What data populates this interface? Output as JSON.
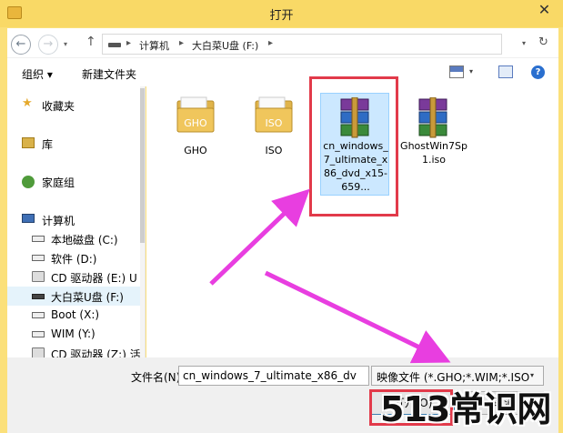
{
  "window": {
    "title": "打开",
    "close_glyph": "✕"
  },
  "nav": {
    "back_glyph": "←",
    "forward_glyph": "→",
    "dropdown_glyph": "▾",
    "up_glyph": "↑",
    "refresh_glyph": "↻"
  },
  "address": {
    "crumbs": [
      "计算机",
      "大白菜U盘 (F:)"
    ],
    "separator": "▸"
  },
  "toolbar": {
    "organize": "组织 ▾",
    "new_folder": "新建文件夹",
    "view_dd": "▾",
    "help": "?"
  },
  "sidebar": {
    "items": [
      {
        "label": "收藏夹",
        "icon": "star-icon"
      },
      {
        "label": "库",
        "icon": "library-icon"
      },
      {
        "label": "家庭组",
        "icon": "homegroup-icon"
      },
      {
        "label": "计算机",
        "icon": "computer-icon"
      },
      {
        "label": "本地磁盘 (C:)",
        "icon": "drive-icon"
      },
      {
        "label": "软件 (D:)",
        "icon": "drive-icon"
      },
      {
        "label": "CD 驱动器 (E:) U",
        "icon": "cd-drive-icon"
      },
      {
        "label": "大白菜U盘 (F:)",
        "icon": "usb-drive-icon"
      },
      {
        "label": "Boot (X:)",
        "icon": "drive-icon"
      },
      {
        "label": "WIM (Y:)",
        "icon": "drive-icon"
      },
      {
        "label": "CD 驱动器 (Z:) 活",
        "icon": "cd-drive-icon"
      }
    ]
  },
  "files": [
    {
      "name": "GHO",
      "icon": "folder-icon",
      "badge": "GHO"
    },
    {
      "name": "ISO",
      "icon": "folder-icon",
      "badge": "ISO"
    },
    {
      "name": "cn_windows_7_ultimate_x86_dvd_x15-659...",
      "icon": "rar-archive-icon"
    },
    {
      "name": "GhostWin7Sp1.iso",
      "icon": "rar-archive-icon"
    }
  ],
  "bottom": {
    "filename_label": "文件名(N):",
    "filename_value": "cn_windows_7_ultimate_x86_dv",
    "filter_value": "映像文件 (*.GHO;*.WIM;*.ISO",
    "filter_dd": "▾",
    "open_label": "打开(O)",
    "cancel_label": "取消"
  },
  "watermark": "513常识网",
  "colors": {
    "titlebar": "#f9d966",
    "highlight": "#e23a4a",
    "arrow": "#e83ee0",
    "selection": "#cce8ff"
  }
}
